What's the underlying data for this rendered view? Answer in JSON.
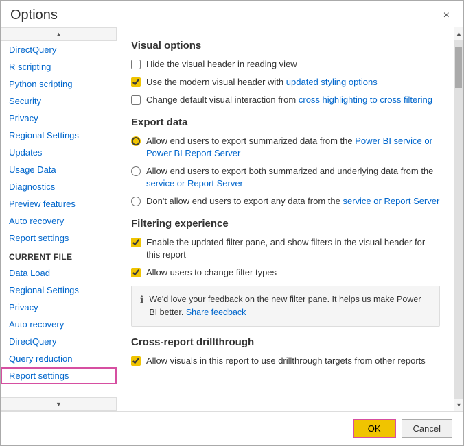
{
  "dialog": {
    "title": "Options",
    "close_label": "×"
  },
  "sidebar": {
    "global_items": [
      {
        "label": "DirectQuery",
        "id": "directquery"
      },
      {
        "label": "R scripting",
        "id": "r-scripting"
      },
      {
        "label": "Python scripting",
        "id": "python-scripting"
      },
      {
        "label": "Security",
        "id": "security"
      },
      {
        "label": "Privacy",
        "id": "privacy"
      },
      {
        "label": "Regional Settings",
        "id": "regional-settings"
      },
      {
        "label": "Updates",
        "id": "updates"
      },
      {
        "label": "Usage Data",
        "id": "usage-data"
      },
      {
        "label": "Diagnostics",
        "id": "diagnostics"
      },
      {
        "label": "Preview features",
        "id": "preview-features"
      },
      {
        "label": "Auto recovery",
        "id": "auto-recovery"
      },
      {
        "label": "Report settings",
        "id": "report-settings"
      }
    ],
    "current_file_header": "CURRENT FILE",
    "current_file_items": [
      {
        "label": "Data Load",
        "id": "data-load"
      },
      {
        "label": "Regional Settings",
        "id": "regional-settings-cf"
      },
      {
        "label": "Privacy",
        "id": "privacy-cf"
      },
      {
        "label": "Auto recovery",
        "id": "auto-recovery-cf"
      },
      {
        "label": "DirectQuery",
        "id": "directquery-cf"
      },
      {
        "label": "Query reduction",
        "id": "query-reduction"
      },
      {
        "label": "Report settings",
        "id": "report-settings-cf",
        "active": true
      }
    ]
  },
  "main": {
    "sections": [
      {
        "id": "visual-options",
        "title": "Visual options",
        "options": [
          {
            "type": "checkbox",
            "checked": false,
            "label": "Hide the visual header in reading view"
          },
          {
            "type": "checkbox",
            "checked": true,
            "label": "Use the modern visual header with updated styling options"
          },
          {
            "type": "checkbox",
            "checked": false,
            "label": "Change default visual interaction from cross highlighting to cross filtering"
          }
        ]
      },
      {
        "id": "export-data",
        "title": "Export data",
        "options": [
          {
            "type": "radio",
            "checked": true,
            "label": "Allow end users to export summarized data from the Power BI service or Power BI Report Server",
            "has_link": false
          },
          {
            "type": "radio",
            "checked": false,
            "label": "Allow end users to export both summarized and underlying data from the service or Report Server"
          },
          {
            "type": "radio",
            "checked": false,
            "label": "Don't allow end users to export any data from the service or Report Server"
          }
        ]
      },
      {
        "id": "filtering-experience",
        "title": "Filtering experience",
        "options": [
          {
            "type": "checkbox",
            "checked": true,
            "label": "Enable the updated filter pane, and show filters in the visual header for this report"
          },
          {
            "type": "checkbox",
            "checked": true,
            "label": "Allow users to change filter types"
          }
        ],
        "feedback": {
          "text": "We'd love your feedback on the new filter pane. It helps us make Power BI better. ",
          "link_text": "Share feedback"
        }
      },
      {
        "id": "cross-report-drillthrough",
        "title": "Cross-report drillthrough",
        "options": [
          {
            "type": "checkbox",
            "checked": true,
            "label": "Allow visuals in this report to use drillthrough targets from other reports"
          }
        ]
      }
    ]
  },
  "footer": {
    "ok_label": "OK",
    "cancel_label": "Cancel"
  },
  "colors": {
    "link": "#0066cc",
    "accent": "#f0c400",
    "active_border": "#d64fa1"
  }
}
